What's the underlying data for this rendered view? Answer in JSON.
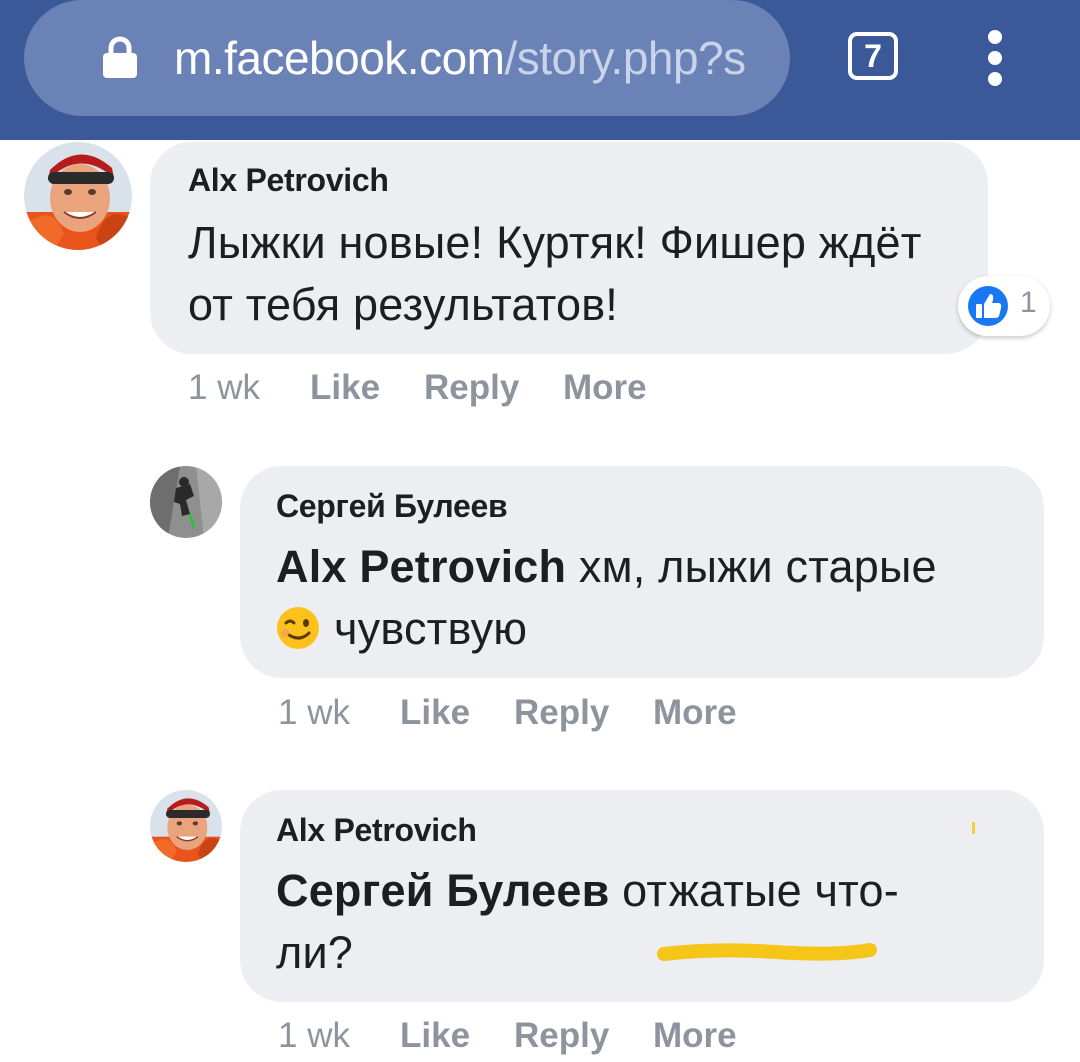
{
  "browser": {
    "url_domain": "m.facebook.com",
    "url_path": "/story.php?s",
    "tab_count": "7",
    "menu_icon": "vertical-dots-icon",
    "lock_icon": "lock-icon"
  },
  "comments": [
    {
      "author": "Alx Petrovich",
      "text": "Лыжки новые! Куртяк! Фишер ждёт от тебя результатов!",
      "time": "1 wk",
      "like_label": "Like",
      "reply_label": "Reply",
      "more_label": "More",
      "reaction_count": "1",
      "reaction_icon": "thumbs-up-icon"
    },
    {
      "author": "Сергей Булеев",
      "mention": "Alx Petrovich",
      "text_before_emoji": "хм, лыжи старые",
      "text_after_emoji": "чувствую",
      "emoji": "winking-face-icon",
      "time": "1 wk",
      "like_label": "Like",
      "reply_label": "Reply",
      "more_label": "More"
    },
    {
      "author": "Alx Petrovich",
      "mention": "Сергей Булеев",
      "text_line1": "отжатые что-",
      "text_line2": "ли?",
      "time": "1 wk",
      "like_label": "Like",
      "reply_label": "Reply",
      "more_label": "More"
    }
  ],
  "colors": {
    "header": "#3b5998",
    "bubble": "#eceef1",
    "meta_text": "#8d949e",
    "like_blue": "#1877f2",
    "highlight": "#f5c518"
  }
}
